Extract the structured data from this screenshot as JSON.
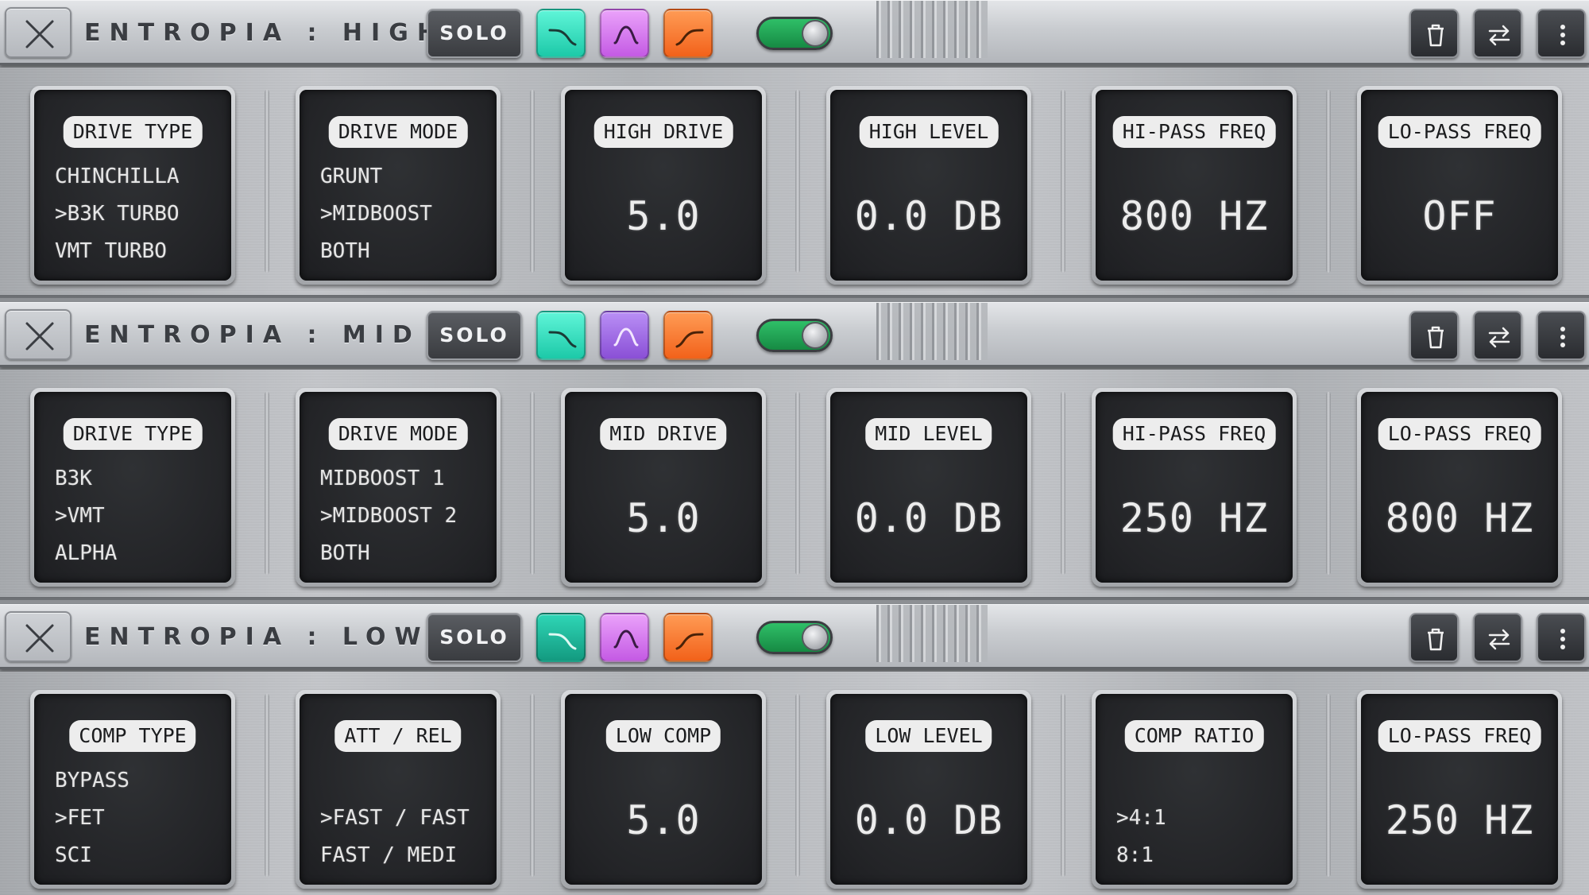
{
  "colors": {
    "hp_button": "#2ee6c4",
    "bp_button": "#d978f0",
    "lp_button": "#ff7a2a",
    "toggle_on": "#22b45a",
    "screen_bg": "#242528",
    "pill_bg": "#ededed"
  },
  "icons": [
    "close-icon",
    "highpass-filter-icon",
    "bandpass-filter-icon",
    "lowpass-filter-icon",
    "trash-icon",
    "swap-icon",
    "kebab-menu-icon"
  ],
  "modules": [
    {
      "title": "ENTROPIA : HIGH",
      "solo_label": "SOLO",
      "bypass_on": true,
      "panels": [
        {
          "label": "DRIVE TYPE",
          "options": [
            "CHINCHILLA",
            ">B3K TURBO",
            "VMT TURBO"
          ]
        },
        {
          "label": "DRIVE MODE",
          "options": [
            "GRUNT",
            ">MIDBOOST",
            "BOTH"
          ]
        },
        {
          "label": "HIGH DRIVE",
          "value": "5.0"
        },
        {
          "label": "HIGH LEVEL",
          "value": "0.0 DB"
        },
        {
          "label": "HI-PASS FREQ",
          "value": "800 HZ"
        },
        {
          "label": "LO-PASS FREQ",
          "value": "OFF"
        }
      ]
    },
    {
      "title": "ENTROPIA : MID",
      "solo_label": "SOLO",
      "bypass_on": true,
      "panels": [
        {
          "label": "DRIVE TYPE",
          "options": [
            "B3K",
            ">VMT",
            "ALPHA"
          ]
        },
        {
          "label": "DRIVE MODE",
          "options": [
            "MIDBOOST 1",
            ">MIDBOOST 2",
            "BOTH"
          ]
        },
        {
          "label": "MID DRIVE",
          "value": "5.0"
        },
        {
          "label": "MID LEVEL",
          "value": "0.0 DB"
        },
        {
          "label": "HI-PASS FREQ",
          "value": "250 HZ"
        },
        {
          "label": "LO-PASS FREQ",
          "value": "800 HZ"
        }
      ]
    },
    {
      "title": "ENTROPIA : LOW",
      "solo_label": "SOLO",
      "bypass_on": true,
      "panels": [
        {
          "label": "COMP TYPE",
          "options": [
            "BYPASS",
            ">FET",
            "SCI"
          ]
        },
        {
          "label": "ATT / REL",
          "options": [
            "",
            ">FAST / FAST",
            "FAST / MEDI"
          ]
        },
        {
          "label": "LOW COMP",
          "value": "5.0"
        },
        {
          "label": "LOW LEVEL",
          "value": "0.0 DB"
        },
        {
          "label": "COMP RATIO",
          "options": [
            "",
            ">4:1",
            "8:1"
          ]
        },
        {
          "label": "LO-PASS FREQ",
          "value": "250 HZ"
        }
      ]
    }
  ]
}
